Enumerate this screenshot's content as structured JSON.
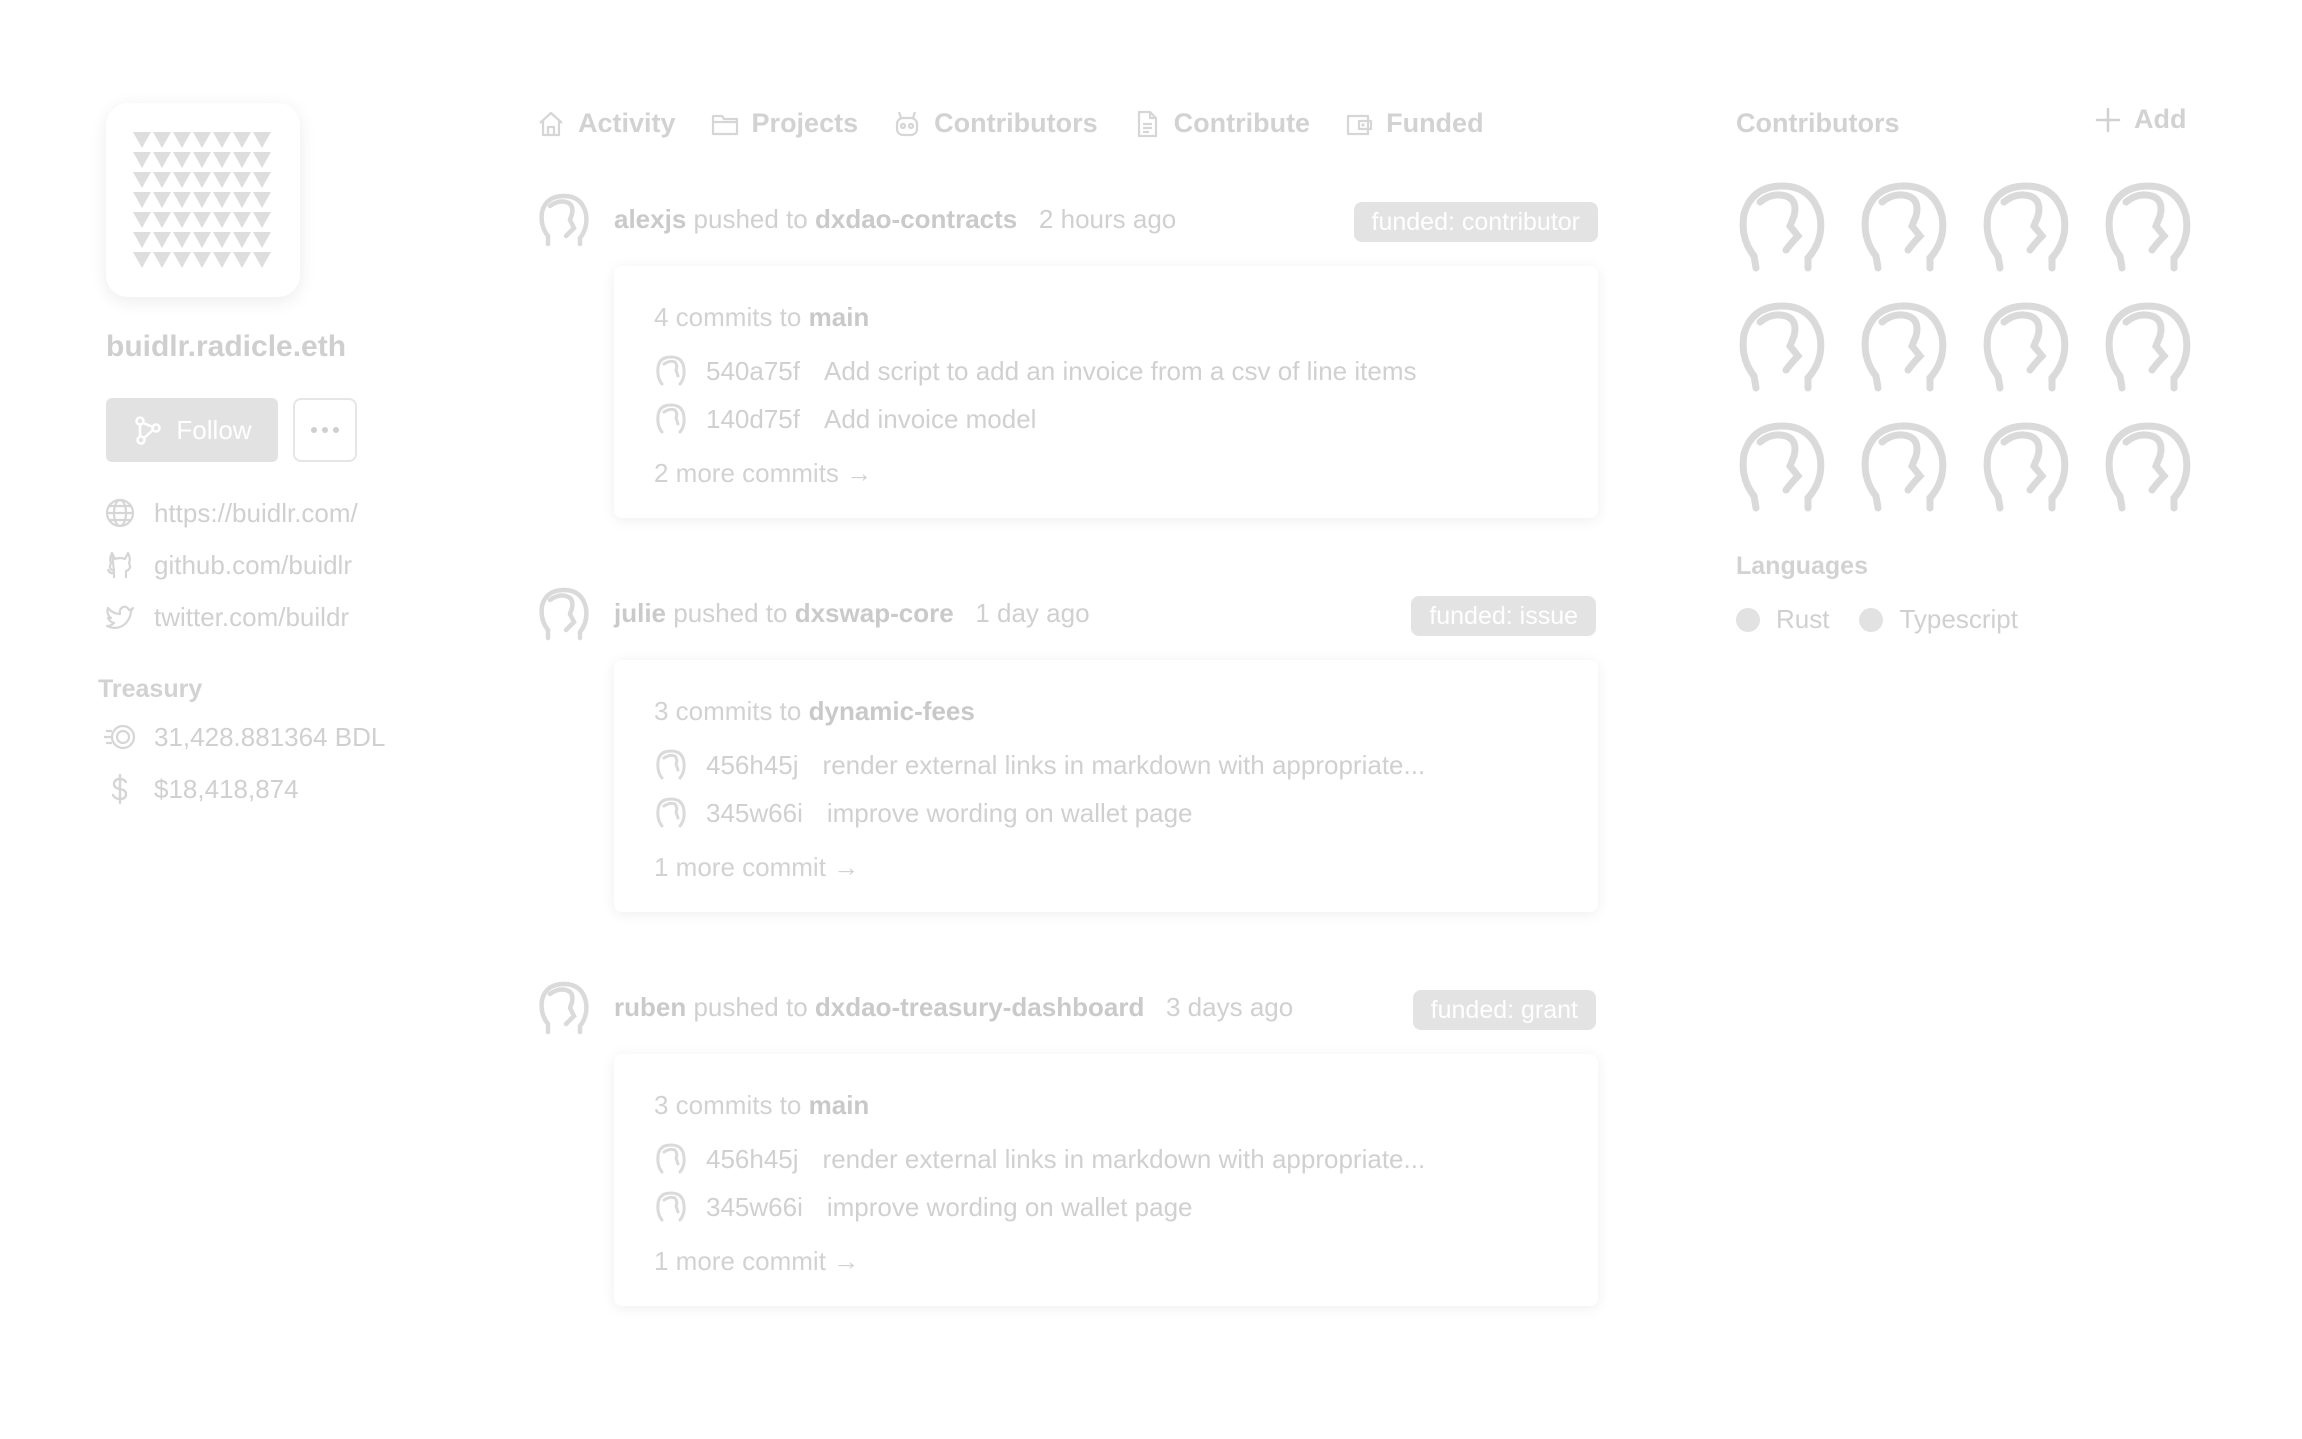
{
  "profile": {
    "name": "buidlr.radicle.eth",
    "follow_label": "Follow",
    "links": [
      {
        "icon": "globe-icon",
        "text": "https://buidlr.com/"
      },
      {
        "icon": "github-icon",
        "text": "github.com/buidlr"
      },
      {
        "icon": "twitter-icon",
        "text": "twitter.com/buildr"
      }
    ],
    "treasury_label": "Treasury",
    "treasury": [
      {
        "icon": "coins-icon",
        "text": "31,428.881364 BDL"
      },
      {
        "icon": "dollar-icon",
        "text": "$18,418,874"
      }
    ]
  },
  "tabs": [
    {
      "icon": "home-icon",
      "label": "Activity"
    },
    {
      "icon": "folder-icon",
      "label": "Projects"
    },
    {
      "icon": "contributors-icon",
      "label": "Contributors"
    },
    {
      "icon": "document-icon",
      "label": "Contribute"
    },
    {
      "icon": "wallet-icon",
      "label": "Funded"
    }
  ],
  "activity": [
    {
      "user": "alexjs",
      "action": "pushed to",
      "repo": "dxdao-contracts",
      "time": "2 hours ago",
      "badge": "funded: contributor",
      "commits_prefix": "4 commits to",
      "branch": "main",
      "commits": [
        {
          "hash": "540a75f",
          "message": "Add script to add an invoice from a csv of line items"
        },
        {
          "hash": "140d75f",
          "message": "Add invoice model"
        }
      ],
      "more": "2 more commits →"
    },
    {
      "user": "julie",
      "action": "pushed to",
      "repo": "dxswap-core",
      "time": "1 day ago",
      "badge": "funded: issue",
      "commits_prefix": "3 commits to",
      "branch": "dynamic-fees",
      "commits": [
        {
          "hash": "456h45j",
          "message": "render external links in markdown with appropriate..."
        },
        {
          "hash": "345w66i",
          "message": "improve wording on wallet page"
        }
      ],
      "more": "1 more commit →"
    },
    {
      "user": "ruben",
      "action": "pushed to",
      "repo": "dxdao-treasury-dashboard",
      "time": "3 days ago",
      "badge": "funded: grant",
      "commits_prefix": "3 commits to",
      "branch": "main",
      "commits": [
        {
          "hash": "456h45j",
          "message": "render external links in markdown with appropriate..."
        },
        {
          "hash": "345w66i",
          "message": "improve wording on wallet page"
        }
      ],
      "more": "1 more commit →"
    }
  ],
  "sidebar": {
    "contributors_title": "Contributors",
    "add_label": "Add",
    "contributor_count": 12,
    "languages_title": "Languages",
    "languages": [
      "Rust",
      "Typescript"
    ]
  },
  "colors": {
    "text_faded": "#cfcfcf",
    "badge_bg": "#e3e3e3",
    "button_bg": "#e2e2e2"
  }
}
